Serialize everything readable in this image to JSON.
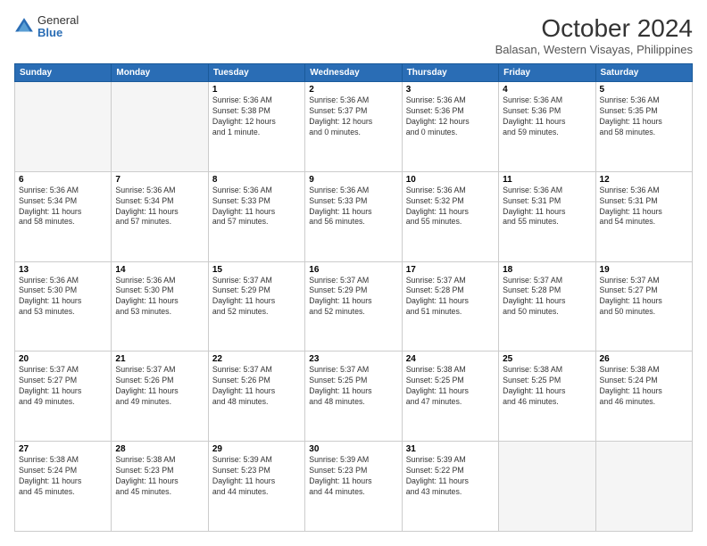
{
  "logo": {
    "general": "General",
    "blue": "Blue"
  },
  "header": {
    "month": "October 2024",
    "location": "Balasan, Western Visayas, Philippines"
  },
  "weekdays": [
    "Sunday",
    "Monday",
    "Tuesday",
    "Wednesday",
    "Thursday",
    "Friday",
    "Saturday"
  ],
  "weeks": [
    [
      {
        "day": "",
        "info": ""
      },
      {
        "day": "",
        "info": ""
      },
      {
        "day": "1",
        "info": "Sunrise: 5:36 AM\nSunset: 5:38 PM\nDaylight: 12 hours\nand 1 minute."
      },
      {
        "day": "2",
        "info": "Sunrise: 5:36 AM\nSunset: 5:37 PM\nDaylight: 12 hours\nand 0 minutes."
      },
      {
        "day": "3",
        "info": "Sunrise: 5:36 AM\nSunset: 5:36 PM\nDaylight: 12 hours\nand 0 minutes."
      },
      {
        "day": "4",
        "info": "Sunrise: 5:36 AM\nSunset: 5:36 PM\nDaylight: 11 hours\nand 59 minutes."
      },
      {
        "day": "5",
        "info": "Sunrise: 5:36 AM\nSunset: 5:35 PM\nDaylight: 11 hours\nand 58 minutes."
      }
    ],
    [
      {
        "day": "6",
        "info": "Sunrise: 5:36 AM\nSunset: 5:34 PM\nDaylight: 11 hours\nand 58 minutes."
      },
      {
        "day": "7",
        "info": "Sunrise: 5:36 AM\nSunset: 5:34 PM\nDaylight: 11 hours\nand 57 minutes."
      },
      {
        "day": "8",
        "info": "Sunrise: 5:36 AM\nSunset: 5:33 PM\nDaylight: 11 hours\nand 57 minutes."
      },
      {
        "day": "9",
        "info": "Sunrise: 5:36 AM\nSunset: 5:33 PM\nDaylight: 11 hours\nand 56 minutes."
      },
      {
        "day": "10",
        "info": "Sunrise: 5:36 AM\nSunset: 5:32 PM\nDaylight: 11 hours\nand 55 minutes."
      },
      {
        "day": "11",
        "info": "Sunrise: 5:36 AM\nSunset: 5:31 PM\nDaylight: 11 hours\nand 55 minutes."
      },
      {
        "day": "12",
        "info": "Sunrise: 5:36 AM\nSunset: 5:31 PM\nDaylight: 11 hours\nand 54 minutes."
      }
    ],
    [
      {
        "day": "13",
        "info": "Sunrise: 5:36 AM\nSunset: 5:30 PM\nDaylight: 11 hours\nand 53 minutes."
      },
      {
        "day": "14",
        "info": "Sunrise: 5:36 AM\nSunset: 5:30 PM\nDaylight: 11 hours\nand 53 minutes."
      },
      {
        "day": "15",
        "info": "Sunrise: 5:37 AM\nSunset: 5:29 PM\nDaylight: 11 hours\nand 52 minutes."
      },
      {
        "day": "16",
        "info": "Sunrise: 5:37 AM\nSunset: 5:29 PM\nDaylight: 11 hours\nand 52 minutes."
      },
      {
        "day": "17",
        "info": "Sunrise: 5:37 AM\nSunset: 5:28 PM\nDaylight: 11 hours\nand 51 minutes."
      },
      {
        "day": "18",
        "info": "Sunrise: 5:37 AM\nSunset: 5:28 PM\nDaylight: 11 hours\nand 50 minutes."
      },
      {
        "day": "19",
        "info": "Sunrise: 5:37 AM\nSunset: 5:27 PM\nDaylight: 11 hours\nand 50 minutes."
      }
    ],
    [
      {
        "day": "20",
        "info": "Sunrise: 5:37 AM\nSunset: 5:27 PM\nDaylight: 11 hours\nand 49 minutes."
      },
      {
        "day": "21",
        "info": "Sunrise: 5:37 AM\nSunset: 5:26 PM\nDaylight: 11 hours\nand 49 minutes."
      },
      {
        "day": "22",
        "info": "Sunrise: 5:37 AM\nSunset: 5:26 PM\nDaylight: 11 hours\nand 48 minutes."
      },
      {
        "day": "23",
        "info": "Sunrise: 5:37 AM\nSunset: 5:25 PM\nDaylight: 11 hours\nand 48 minutes."
      },
      {
        "day": "24",
        "info": "Sunrise: 5:38 AM\nSunset: 5:25 PM\nDaylight: 11 hours\nand 47 minutes."
      },
      {
        "day": "25",
        "info": "Sunrise: 5:38 AM\nSunset: 5:25 PM\nDaylight: 11 hours\nand 46 minutes."
      },
      {
        "day": "26",
        "info": "Sunrise: 5:38 AM\nSunset: 5:24 PM\nDaylight: 11 hours\nand 46 minutes."
      }
    ],
    [
      {
        "day": "27",
        "info": "Sunrise: 5:38 AM\nSunset: 5:24 PM\nDaylight: 11 hours\nand 45 minutes."
      },
      {
        "day": "28",
        "info": "Sunrise: 5:38 AM\nSunset: 5:23 PM\nDaylight: 11 hours\nand 45 minutes."
      },
      {
        "day": "29",
        "info": "Sunrise: 5:39 AM\nSunset: 5:23 PM\nDaylight: 11 hours\nand 44 minutes."
      },
      {
        "day": "30",
        "info": "Sunrise: 5:39 AM\nSunset: 5:23 PM\nDaylight: 11 hours\nand 44 minutes."
      },
      {
        "day": "31",
        "info": "Sunrise: 5:39 AM\nSunset: 5:22 PM\nDaylight: 11 hours\nand 43 minutes."
      },
      {
        "day": "",
        "info": ""
      },
      {
        "day": "",
        "info": ""
      }
    ]
  ]
}
